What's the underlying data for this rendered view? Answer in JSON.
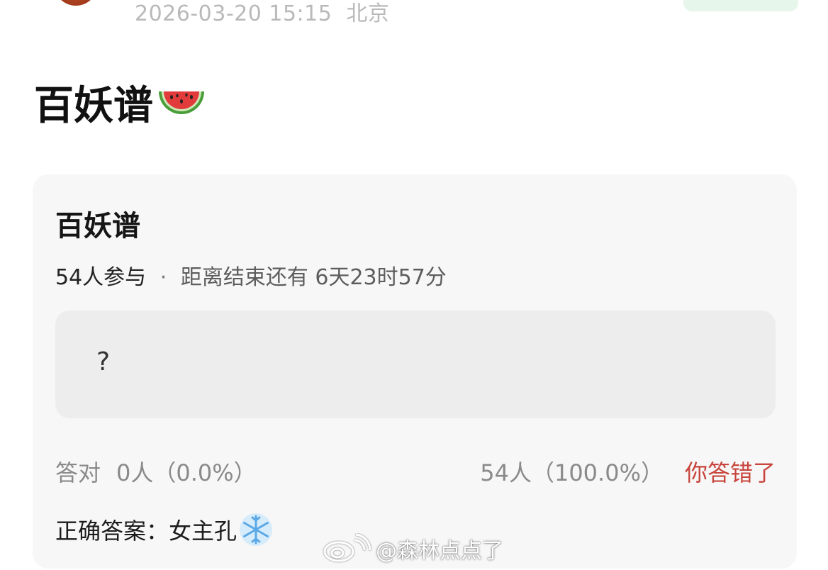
{
  "header": {
    "timestamp": "2026-03-20 15:15",
    "location": "北京",
    "avatar_icon": "avatar-image",
    "follow_button_color": "#e6f6ea"
  },
  "post": {
    "title": "百妖谱",
    "title_emoji_icon": "watermelon-icon"
  },
  "poll": {
    "title": "百妖谱",
    "participants": "54人参与",
    "separator": "·",
    "remaining": "距离结束还有 6天23时57分",
    "option_text": "?",
    "correct_label": "答对",
    "correct_count": "0人（0.0%）",
    "wrong_count": "54人（100.0%）",
    "wrong_label": "你答错了",
    "wrong_color": "#c8443c",
    "answer_label": "正确答案：女主孔",
    "answer_emoji_icon": "snowflake-icon"
  },
  "watermark": {
    "logo_icon": "weibo-logo-icon",
    "text": "@森林点点了"
  }
}
